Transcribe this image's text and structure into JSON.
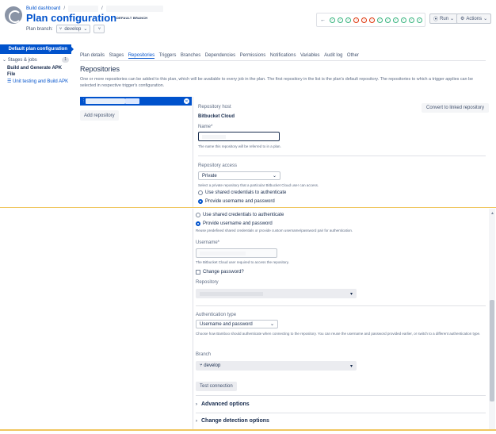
{
  "header": {
    "breadcrumb_root": "Build dashboard",
    "breadcrumb_sep": "/",
    "title": "Plan configuration",
    "default_branch_badge": "DEFAULT BRANCH",
    "plan_branch_label": "Plan branch:",
    "plan_branch_value": "develop",
    "run_label": "Run",
    "actions_label": "Actions"
  },
  "build_status": [
    "ok",
    "ok",
    "ok",
    "fail",
    "fail",
    "fail",
    "ok",
    "ok",
    "ok",
    "ok",
    "ok",
    "ok"
  ],
  "colors": {
    "accent": "#0052cc",
    "success": "#36b37e",
    "failure": "#de350b"
  },
  "sidebar": {
    "active_item": "Default plan configuration",
    "stages_label": "Stages & jobs",
    "stages_count": "1",
    "stage_name": "Build and Generate APK File",
    "job_name": "Unit testing and Build APK"
  },
  "tabs": [
    "Plan details",
    "Stages",
    "Repositories",
    "Triggers",
    "Branches",
    "Dependencies",
    "Permissions",
    "Notifications",
    "Variables",
    "Audit log",
    "Other"
  ],
  "active_tab": "Repositories",
  "main": {
    "section_title": "Repositories",
    "section_desc": "One or more repositories can be added to this plan, which will be available to every job in the plan. The first repository in the list is the plan's default repository. The repositories to which a trigger applies can be selected in respective trigger's configuration.",
    "add_repository": "Add repository",
    "convert_button": "Convert to linked repository",
    "repo_host_label": "Repository host",
    "repo_host_value": "Bitbucket Cloud",
    "name_label": "Name*",
    "name_help": "The name this repository will be referred to in a plan.",
    "access_label": "Repository access",
    "access_value": "Private",
    "access_help": "Select a private repository that a particular Bitbucket Cloud user can access.",
    "radio_shared": "Use shared credentials to authenticate",
    "radio_provide": "Provide username and password",
    "reuse_help": "Reuse predefined shared credentials or provide custom username/password pair for authentication.",
    "username_label": "Username*",
    "username_help": "The Bitbucket Cloud user required to access the repository.",
    "change_password": "Change password?",
    "repository_label": "Repository",
    "auth_type_label": "Authentication type",
    "auth_type_value": "Username and password",
    "auth_help": "Choose how Bamboo should authenticate when connecting to the repository. You can reuse the username and password provided earlier, or switch to a different authentication type.",
    "branch_label": "Branch",
    "branch_value": "develop",
    "test_connection": "Test connection",
    "advanced_options": "Advanced options",
    "change_detection": "Change detection options"
  }
}
